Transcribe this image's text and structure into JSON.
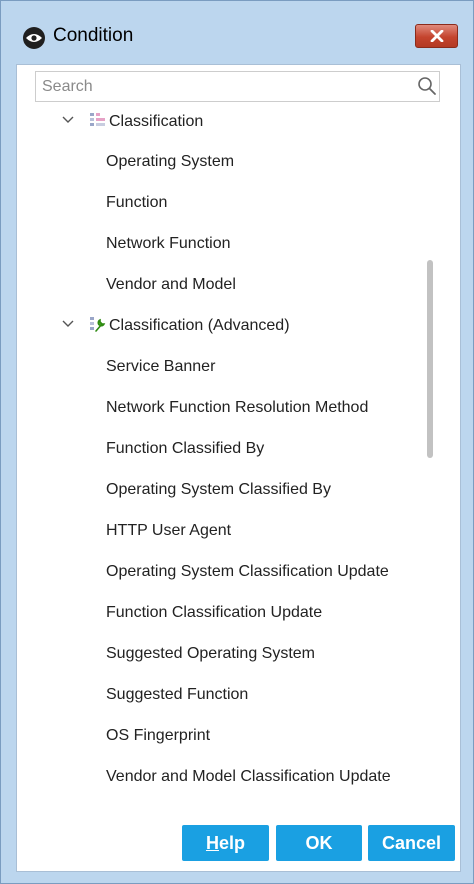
{
  "window": {
    "title": "Condition",
    "close_icon": "close-x-icon",
    "title_icon": "eye-icon"
  },
  "search": {
    "placeholder": "Search",
    "value": ""
  },
  "tree": {
    "groups": [
      {
        "label": "Classification",
        "expanded": true,
        "icon": "classification-icon",
        "items": [
          "Operating System",
          "Function",
          "Network Function",
          "Vendor and Model"
        ]
      },
      {
        "label": "Classification (Advanced)",
        "expanded": true,
        "icon": "advanced-classification-wrench-icon",
        "items": [
          "Service Banner",
          "Network Function Resolution Method",
          "Function Classified By",
          "Operating System Classified By",
          "HTTP User Agent",
          "Operating System Classification Update",
          "Function Classification Update",
          "Suggested Operating System",
          "Suggested Function",
          "OS Fingerprint",
          "Vendor and Model Classification Update"
        ]
      }
    ]
  },
  "buttons": {
    "help_first": "H",
    "help_rest": "elp",
    "ok": "OK",
    "cancel": "Cancel"
  },
  "colors": {
    "accent": "#1aa0e2",
    "close_red": "#c4442e",
    "frame": "#bcd6ee"
  }
}
